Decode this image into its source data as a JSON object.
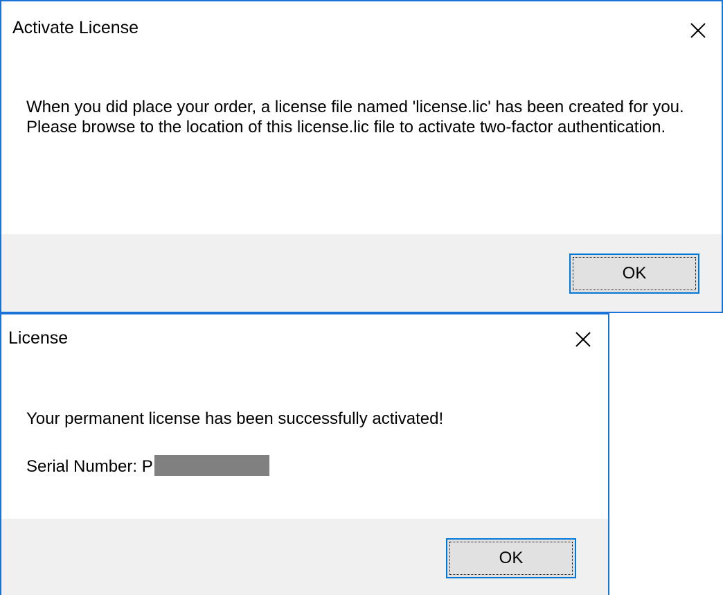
{
  "dialogs": {
    "activate": {
      "title": "Activate License",
      "message_line1": "When you did place your order, a license file named 'license.lic' has been created for you.",
      "message_line2": "Please browse to the location of this license.lic file to activate two-factor authentication.",
      "ok_label": "OK",
      "close_icon": "close-icon"
    },
    "license": {
      "title": "License",
      "message": "Your permanent license has been successfully activated!",
      "serial_label": "Serial Number: P",
      "ok_label": "OK",
      "close_icon": "close-icon"
    }
  },
  "colors": {
    "window_border": "#1a73d9",
    "footer_bg": "#f0f0f0",
    "button_bg": "#e1e1e1",
    "button_border": "#0078d7",
    "redaction": "#808080"
  }
}
